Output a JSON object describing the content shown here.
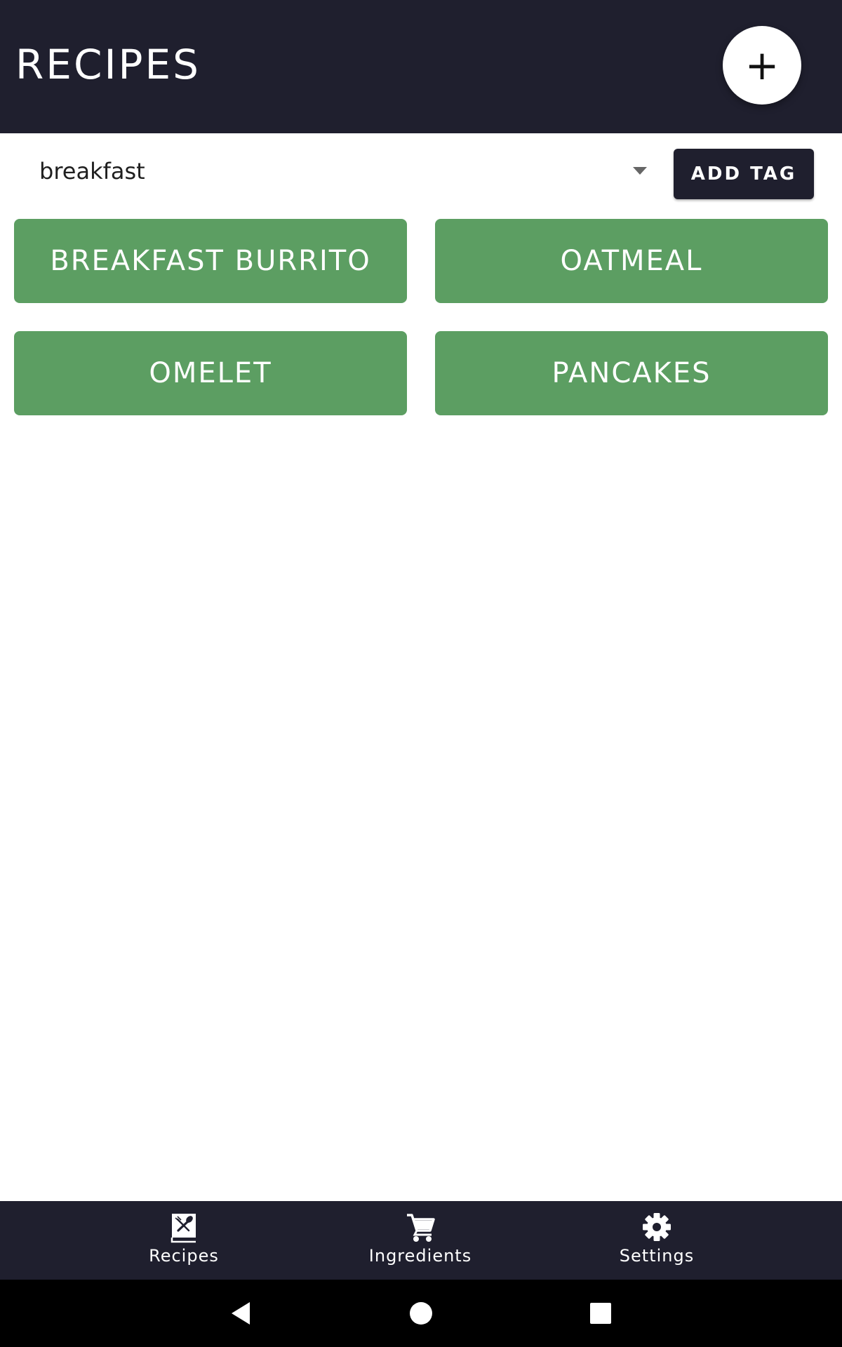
{
  "app_bar": {
    "title": "RECIPES",
    "add_label": "+"
  },
  "filter": {
    "selected_tag": "breakfast",
    "add_tag_label": "ADD TAG"
  },
  "recipes": [
    {
      "label": "BREAKFAST BURRITO"
    },
    {
      "label": "OATMEAL"
    },
    {
      "label": "OMELET"
    },
    {
      "label": "PANCAKES"
    }
  ],
  "bottom_nav": {
    "items": [
      {
        "label": "Recipes",
        "icon": "recipe-book-icon"
      },
      {
        "label": "Ingredients",
        "icon": "shopping-cart-icon"
      },
      {
        "label": "Settings",
        "icon": "gear-icon"
      }
    ]
  },
  "system_nav": {
    "buttons": [
      "back-icon",
      "home-icon",
      "recents-icon"
    ]
  },
  "colors": {
    "primary_dark": "#1f1f2e",
    "recipe_green": "#5c9e62",
    "background": "#ffffff"
  }
}
